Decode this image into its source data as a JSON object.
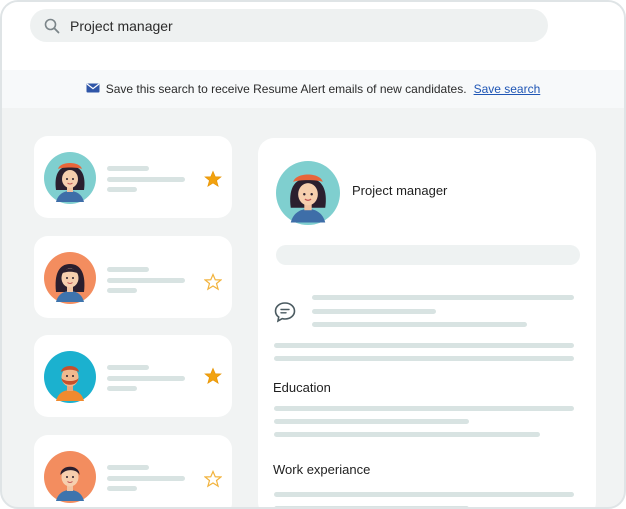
{
  "search": {
    "query": "Project manager"
  },
  "alert": {
    "message": "Save this search to receive Resume Alert emails of new candidates.",
    "link_label": "Save search"
  },
  "candidates": [
    {
      "avatar": "woman-beret-avatar",
      "starred": true
    },
    {
      "avatar": "woman-avatar",
      "starred": false
    },
    {
      "avatar": "bearded-man-avatar",
      "starred": true
    },
    {
      "avatar": "man-avatar",
      "starred": false
    }
  ],
  "detail": {
    "title": "Project manager",
    "sections": [
      "Education",
      "Work experiance"
    ]
  },
  "colors": {
    "star_filled": "#f2a20f",
    "star_outline": "#f2b33d",
    "placeholder_line": "#d8e3e2",
    "link": "#1f56b5"
  }
}
